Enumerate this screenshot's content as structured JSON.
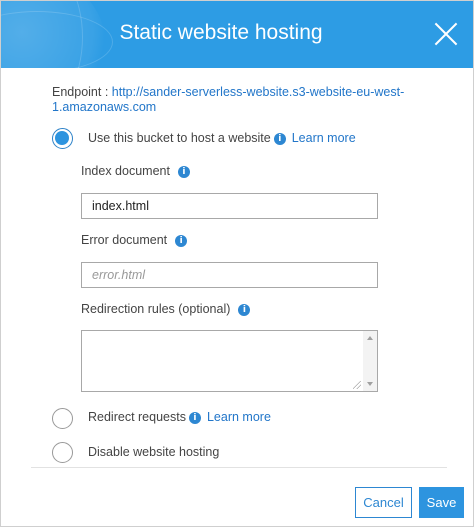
{
  "dialog": {
    "title": "Static website hosting"
  },
  "endpoint": {
    "label": "Endpoint :",
    "url": "http://sander-serverless-website.s3-website-eu-west-1.amazonaws.com"
  },
  "options": {
    "host": {
      "label": "Use this bucket to host a website",
      "learn_more": "Learn more",
      "selected": true
    },
    "redirect": {
      "label": "Redirect requests",
      "learn_more": "Learn more",
      "selected": false
    },
    "disable": {
      "label": "Disable website hosting",
      "selected": false
    }
  },
  "fields": {
    "index": {
      "label": "Index document",
      "value": "index.html"
    },
    "error": {
      "label": "Error document",
      "placeholder": "error.html",
      "value": ""
    },
    "redirection": {
      "label": "Redirection rules (optional)",
      "value": ""
    }
  },
  "footer": {
    "cancel_label": "Cancel",
    "save_label": "Save"
  },
  "colors": {
    "header": "#2d9ce4",
    "accent": "#2d87d2",
    "link": "#2276c9"
  },
  "icons": {
    "close": "close-icon",
    "info": "info-icon"
  }
}
